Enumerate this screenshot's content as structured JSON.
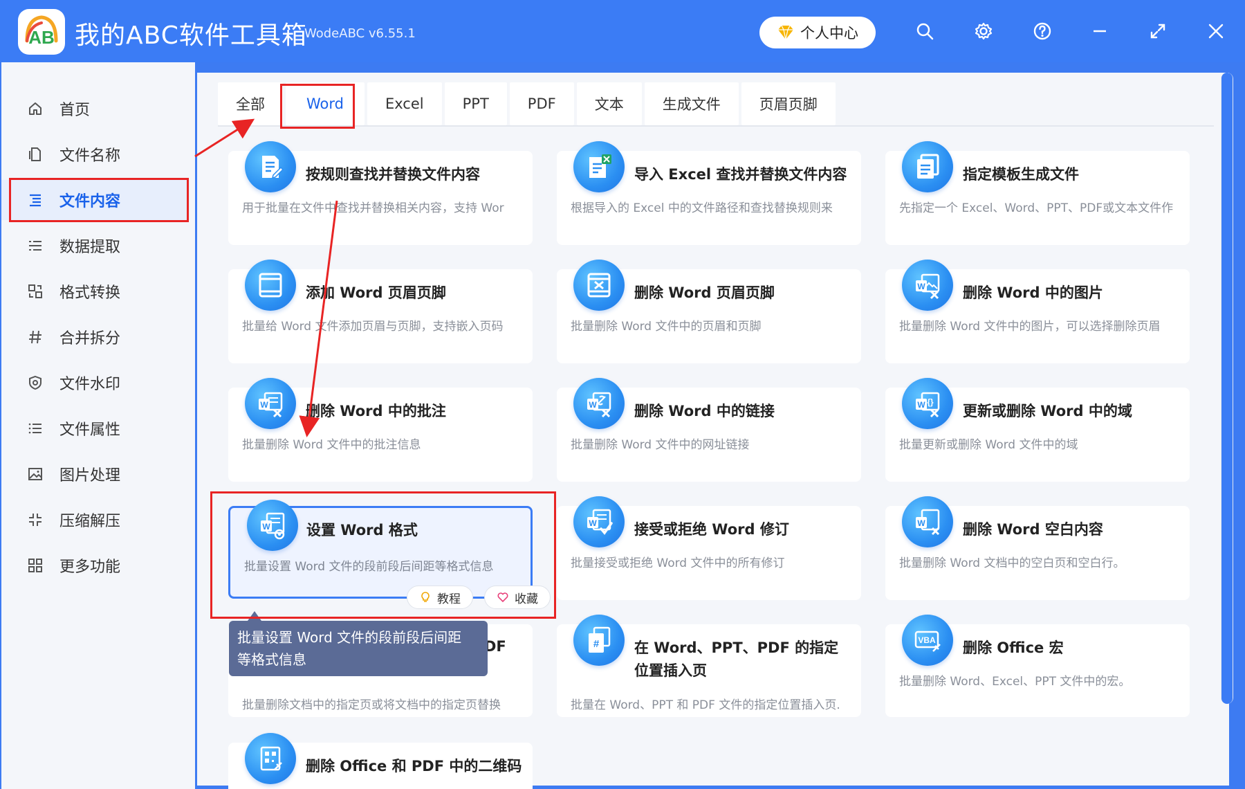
{
  "app": {
    "title": "我的ABC软件工具箱",
    "version": "WodeABC v6.55.1",
    "user_center": "个人中心",
    "logo_text": "AB"
  },
  "sidebar": {
    "items": [
      {
        "label": "首页",
        "icon": "home-icon"
      },
      {
        "label": "文件名称",
        "icon": "file-name-icon"
      },
      {
        "label": "文件内容",
        "icon": "file-content-icon",
        "active": true
      },
      {
        "label": "数据提取",
        "icon": "data-extract-icon"
      },
      {
        "label": "格式转换",
        "icon": "format-convert-icon"
      },
      {
        "label": "合并拆分",
        "icon": "hash-icon"
      },
      {
        "label": "文件水印",
        "icon": "watermark-icon"
      },
      {
        "label": "文件属性",
        "icon": "list-icon"
      },
      {
        "label": "图片处理",
        "icon": "image-icon"
      },
      {
        "label": "压缩解压",
        "icon": "compress-icon"
      },
      {
        "label": "更多功能",
        "icon": "grid-icon"
      }
    ]
  },
  "tabs": [
    "全部",
    "Word",
    "Excel",
    "PPT",
    "PDF",
    "文本",
    "生成文件",
    "页眉页脚"
  ],
  "active_tab": "Word",
  "cards": [
    {
      "title": "按规则查找并替换文件内容",
      "desc": "用于批量在文件中查找并替换相关内容，支持 Wor"
    },
    {
      "title": "导入 Excel 查找并替换文件内容",
      "desc": "根据导入的 Excel 中的文件路径和查找替换规则来"
    },
    {
      "title": "指定模板生成文件",
      "desc": "先指定一个 Excel、Word、PPT、PDF或文本文件作"
    },
    {
      "title": "添加 Word 页眉页脚",
      "desc": "批量给 Word 文件添加页眉与页脚，支持嵌入页码"
    },
    {
      "title": "删除 Word 页眉页脚",
      "desc": "批量删除 Word 文件中的页眉和页脚"
    },
    {
      "title": "删除 Word 中的图片",
      "desc": "批量删除 Word 文件中的图片，可以选择删除页眉"
    },
    {
      "title": "删除 Word 中的批注",
      "desc": "批量删除 Word 文件中的批注信息"
    },
    {
      "title": "删除 Word 中的链接",
      "desc": "批量删除 Word 文件中的网址链接"
    },
    {
      "title": "更新或删除 Word 中的域",
      "desc": "批量更新或删除 Word 文件中的域"
    },
    {
      "title": "设置 Word 格式",
      "desc": "批量设置 Word 文件的段前段后间距等格式信息"
    },
    {
      "title": "接受或拒绝 Word 修订",
      "desc": "批量接受或拒绝 Word 文件中的所有修订"
    },
    {
      "title": "删除 Word 空白内容",
      "desc": "批量删除 Word 文档中的空白页和空白行。"
    },
    {
      "title": "DF",
      "desc": "批量删除文档中的指定页或将文档中的指定页替换"
    },
    {
      "title": "在 Word、PPT、PDF 的指定位置插入页",
      "desc": "批量在 Word、PPT 和 PDF 文件的指定位置插入页."
    },
    {
      "title": "删除 Office 宏",
      "desc": "批量删除 Word、Excel、PPT 文件中的宏。"
    },
    {
      "title": "删除 Office 和 PDF 中的二维码",
      "desc": ""
    }
  ],
  "hover_actions": {
    "tutorial": "教程",
    "favorite": "收藏"
  },
  "tooltip": {
    "line1": "批量设置 Word 文件的段前段后间距",
    "line2": "等格式信息"
  },
  "colors": {
    "brand": "#3b7cf5",
    "active_text": "#1a62ea",
    "annotation": "#e82424"
  }
}
